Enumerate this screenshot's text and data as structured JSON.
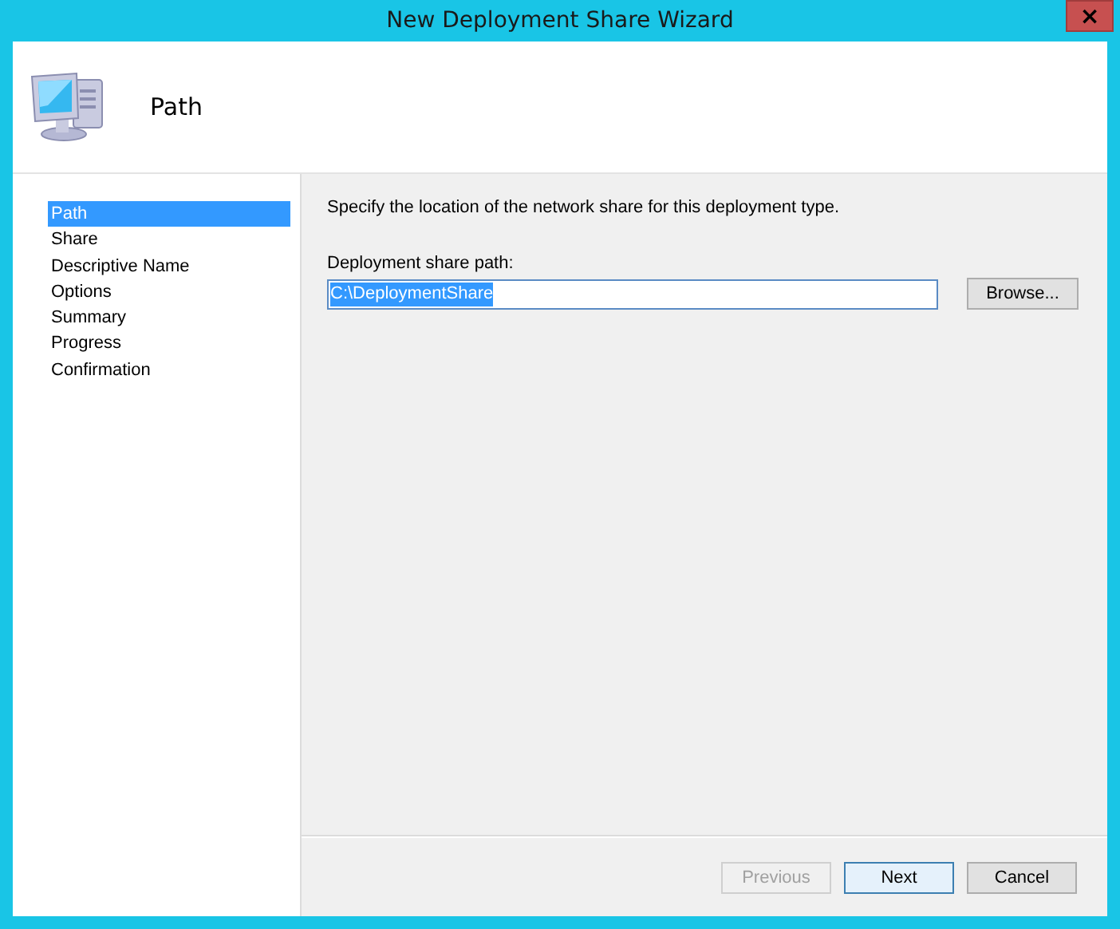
{
  "window": {
    "title": "New Deployment Share Wizard",
    "close": "×"
  },
  "header": {
    "title": "Path"
  },
  "steps": [
    {
      "label": "Path",
      "selected": true
    },
    {
      "label": "Share",
      "selected": false
    },
    {
      "label": "Descriptive Name",
      "selected": false
    },
    {
      "label": "Options",
      "selected": false
    },
    {
      "label": "Summary",
      "selected": false
    },
    {
      "label": "Progress",
      "selected": false
    },
    {
      "label": "Confirmation",
      "selected": false
    }
  ],
  "instruction": "Specify the location of the network share for this deployment type.",
  "path_field": {
    "label": "Deployment share path:",
    "value": "C:\\DeploymentShare",
    "selected": true,
    "browse": "Browse..."
  },
  "buttons": [
    {
      "label": "Previous",
      "disabled": true,
      "focused": false
    },
    {
      "label": "Next",
      "disabled": false,
      "focused": true
    },
    {
      "label": "Cancel",
      "disabled": false,
      "focused": false
    }
  ]
}
